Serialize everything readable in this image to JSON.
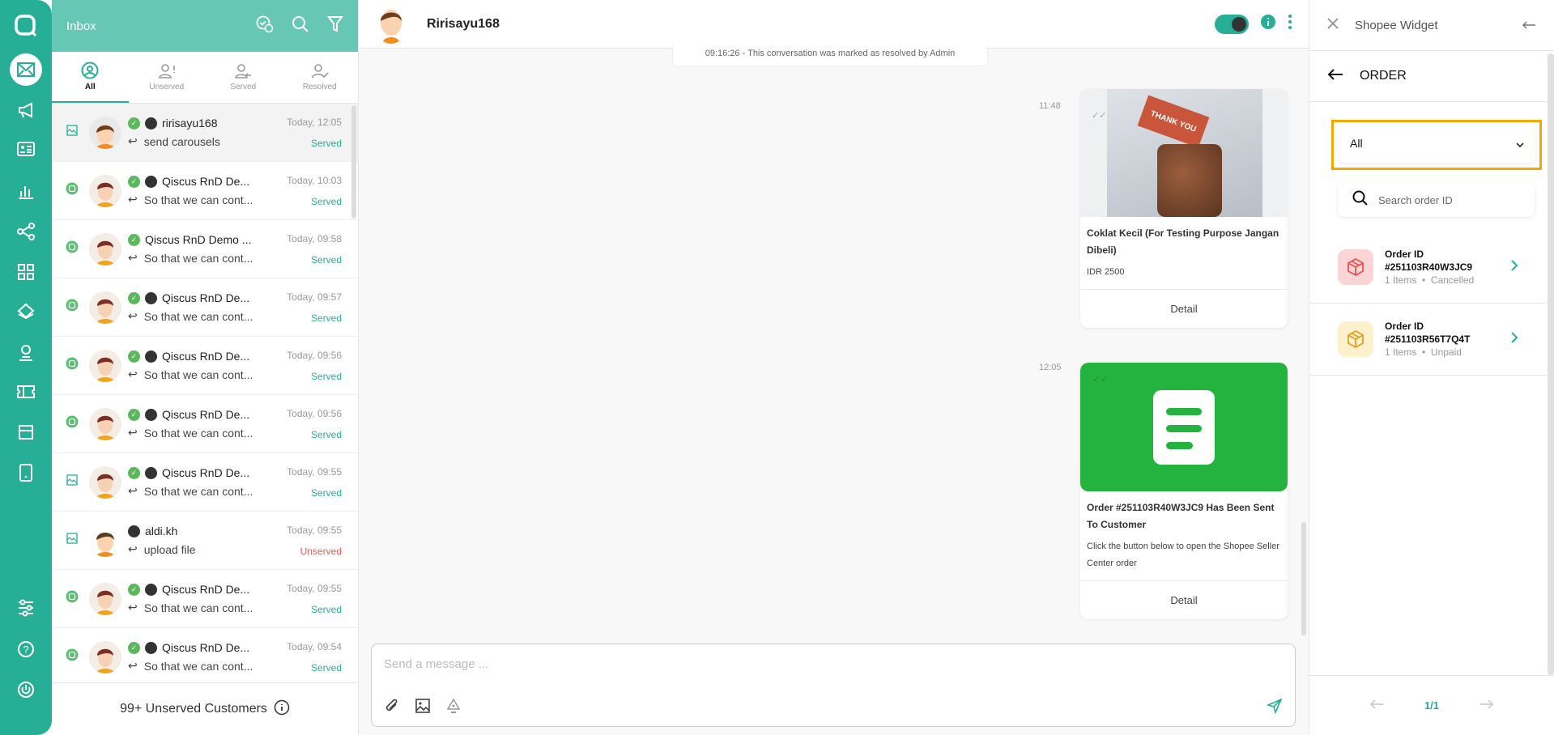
{
  "inbox": {
    "title": "Inbox",
    "tabs": [
      "All",
      "Unserved",
      "Served",
      "Resolved"
    ],
    "footer": "99+ Unserved Customers"
  },
  "conversations": [
    {
      "name": "ririsayu168",
      "time": "Today, 12:05",
      "preview": "send carousels",
      "status": "Served",
      "channel": "image",
      "verified": true,
      "shopee": true,
      "selected": true,
      "avatar": "girl"
    },
    {
      "name": "Qiscus RnD De...",
      "time": "Today, 10:03",
      "preview": "So that we can cont...",
      "status": "Served",
      "channel": "chat",
      "verified": true,
      "shopee": true,
      "avatar": "man"
    },
    {
      "name": "Qiscus RnD Demo ...",
      "time": "Today, 09:58",
      "preview": "So that we can cont...",
      "status": "Served",
      "channel": "chat",
      "verified": true,
      "shopee": false,
      "avatar": "man"
    },
    {
      "name": "Qiscus RnD De...",
      "time": "Today, 09:57",
      "preview": "So that we can cont...",
      "status": "Served",
      "channel": "chat",
      "verified": true,
      "shopee": true,
      "avatar": "man"
    },
    {
      "name": "Qiscus RnD De...",
      "time": "Today, 09:56",
      "preview": "So that we can cont...",
      "status": "Served",
      "channel": "chat",
      "verified": true,
      "shopee": true,
      "avatar": "man"
    },
    {
      "name": "Qiscus RnD De...",
      "time": "Today, 09:56",
      "preview": "So that we can cont...",
      "status": "Served",
      "channel": "chat",
      "verified": true,
      "shopee": true,
      "avatar": "man"
    },
    {
      "name": "Qiscus RnD De...",
      "time": "Today, 09:55",
      "preview": "So that we can cont...",
      "status": "Served",
      "channel": "image",
      "verified": true,
      "shopee": true,
      "avatar": "man"
    },
    {
      "name": "aldi.kh",
      "time": "Today, 09:55",
      "preview": "upload file",
      "status": "Unserved",
      "channel": "image",
      "verified": false,
      "shopee": true,
      "avatar": "boy"
    },
    {
      "name": "Qiscus RnD De...",
      "time": "Today, 09:55",
      "preview": "So that we can cont...",
      "status": "Served",
      "channel": "chat",
      "verified": true,
      "shopee": true,
      "avatar": "man"
    },
    {
      "name": "Qiscus RnD De...",
      "time": "Today, 09:54",
      "preview": "So that we can cont...",
      "status": "Served",
      "channel": "chat",
      "verified": true,
      "shopee": true,
      "avatar": "man"
    }
  ],
  "chat": {
    "contact_name": "Ririsayu168",
    "system_message": "09:16:26 - This conversation was marked as resolved by Admin",
    "messages": [
      {
        "time": "11:48",
        "title": "Coklat Kecil (For Testing Purpose Jangan Dibeli)",
        "desc": "IDR 2500",
        "button": "Detail",
        "image_text": "THANK YOU"
      },
      {
        "time": "12:05",
        "title": "Order #251103R40W3JC9 Has Been Sent To Customer",
        "desc": "Click the button below to open the Shopee Seller Center order",
        "button": "Detail"
      }
    ],
    "composer_placeholder": "Send a message ..."
  },
  "widget": {
    "title": "Shopee Widget",
    "section": "ORDER",
    "filter": "All",
    "search_placeholder": "Search order ID",
    "orders": [
      {
        "label": "Order ID",
        "id": "#251103R40W3JC9",
        "items": "1 Items",
        "status": "Cancelled",
        "color": "#e55353",
        "bg": "#fbd5d5"
      },
      {
        "label": "Order ID",
        "id": "#251103R56T7Q4T",
        "items": "1 Items",
        "status": "Unpaid",
        "color": "#e0a020",
        "bg": "#fdf0cc"
      }
    ],
    "page": "1/1"
  },
  "colors": {
    "primary": "#27ae96",
    "header": "#66c7b5",
    "highlight": "#f6a800",
    "card_green": "#25b33f"
  }
}
